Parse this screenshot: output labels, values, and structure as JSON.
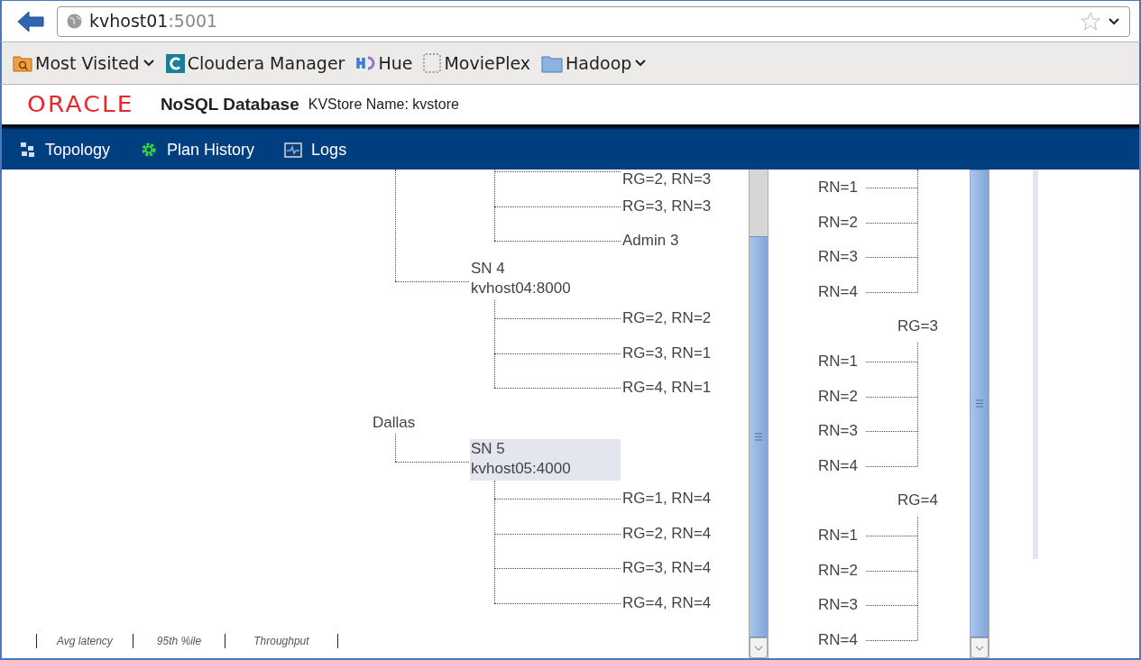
{
  "address_bar": {
    "host": "kvhost01",
    "port": ":5001"
  },
  "bookmarks": [
    {
      "label": "Most Visited",
      "kind": "smart_folder",
      "dropdown": true
    },
    {
      "label": "Cloudera Manager",
      "kind": "cloudera",
      "dropdown": false
    },
    {
      "label": "Hue",
      "kind": "hue",
      "dropdown": false
    },
    {
      "label": "MoviePlex",
      "kind": "page",
      "dropdown": false
    },
    {
      "label": "Hadoop",
      "kind": "folder",
      "dropdown": true
    }
  ],
  "header": {
    "logo": "ORACLE",
    "product": "NoSQL Database",
    "store_name": "KVStore Name: kvstore"
  },
  "nav": [
    {
      "label": "Topology",
      "kind": "topology"
    },
    {
      "label": "Plan History",
      "kind": "plans"
    },
    {
      "label": "Logs",
      "kind": "logs"
    }
  ],
  "topology": [
    {
      "kind": "group_tail",
      "children": [
        {
          "label": "RG=2, RN=3"
        },
        {
          "label": "RG=3, RN=3"
        },
        {
          "label": "Admin 3"
        }
      ]
    },
    {
      "kind": "sn",
      "name": "SN 4",
      "host": "kvhost04:8000",
      "selected": false,
      "children": [
        {
          "label": "RG=2, RN=2"
        },
        {
          "label": "RG=3, RN=1"
        },
        {
          "label": "RG=4, RN=1"
        }
      ]
    },
    {
      "kind": "zone",
      "name": "Dallas",
      "children": [
        {
          "kind": "sn",
          "name": "SN 5",
          "host": "kvhost05:4000",
          "selected": true,
          "children": [
            {
              "label": "RG=1, RN=4"
            },
            {
              "label": "RG=2, RN=4"
            },
            {
              "label": "RG=3, RN=4"
            },
            {
              "label": "RG=4, RN=4"
            }
          ]
        }
      ]
    }
  ],
  "replication_groups": [
    {
      "children": [
        {
          "label": "RN=1"
        },
        {
          "label": "RN=2"
        },
        {
          "label": "RN=3"
        },
        {
          "label": "RN=4"
        }
      ]
    },
    {
      "name": "RG=3",
      "children": [
        {
          "label": "RN=1"
        },
        {
          "label": "RN=2"
        },
        {
          "label": "RN=3"
        },
        {
          "label": "RN=4"
        }
      ]
    },
    {
      "name": "RG=4",
      "children": [
        {
          "label": "RN=1"
        },
        {
          "label": "RN=2"
        },
        {
          "label": "RN=3"
        },
        {
          "label": "RN=4"
        }
      ]
    }
  ],
  "legend": [
    "Avg latency",
    "95th %ile",
    "Throughput"
  ]
}
